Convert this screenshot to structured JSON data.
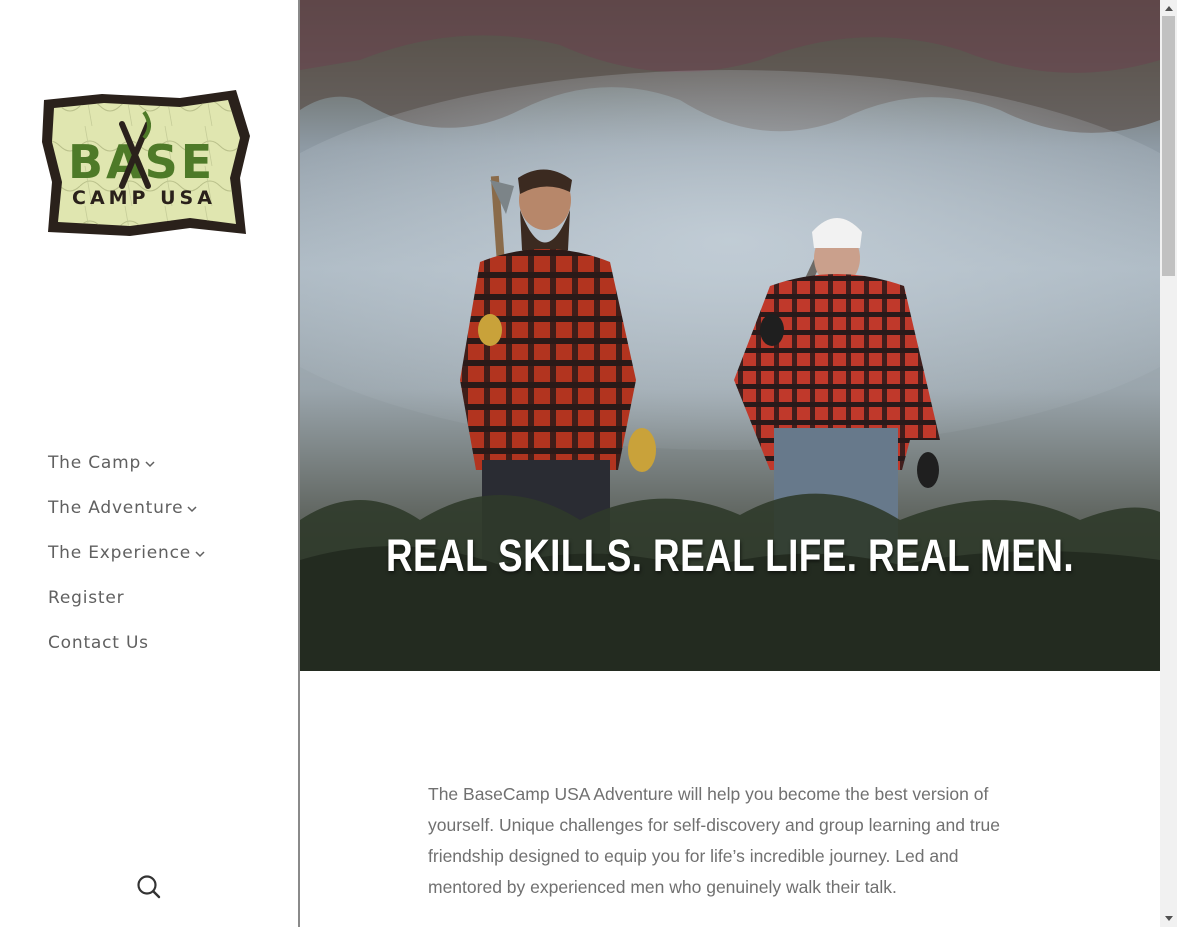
{
  "sidebar": {
    "logo": {
      "line1": "BASE",
      "line2": "CAMP USA",
      "colors": {
        "paper": "#e0e6b0",
        "border": "#2a211b",
        "green": "#4e7a28",
        "dark": "#2a211b"
      }
    },
    "nav": [
      {
        "label": "The Camp",
        "has_dropdown": true
      },
      {
        "label": "The Adventure",
        "has_dropdown": true
      },
      {
        "label": "The Experience",
        "has_dropdown": true
      },
      {
        "label": "Register",
        "has_dropdown": false
      },
      {
        "label": "Contact Us",
        "has_dropdown": false
      }
    ],
    "search_icon": "search-icon"
  },
  "hero": {
    "headline": "REAL SKILLS. REAL LIFE. REAL MEN."
  },
  "content": {
    "intro": "The BaseCamp USA Adventure will help you become the best version of yourself. Unique challenges for self-discovery and group learning and true friendship designed to equip you for life’s incredible journey. Led and mentored by experienced men who genuinely walk their talk."
  },
  "colors": {
    "nav_text": "#606060",
    "body_text": "#707070",
    "plaid_red": "#b2341f"
  }
}
